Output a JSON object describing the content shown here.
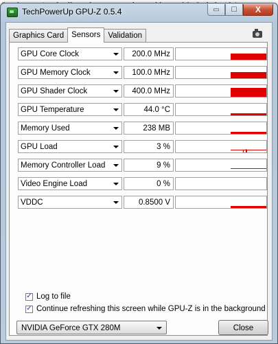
{
  "background_text": "Star International sells cool computers the world over. My Style Inside!",
  "window": {
    "title": "TechPowerUp GPU-Z 0.5.4",
    "minimize_glyph": "▭",
    "restore_glyph": "☐",
    "close_glyph": "X"
  },
  "tabs": [
    {
      "label": "Graphics Card",
      "active": false
    },
    {
      "label": "Sensors",
      "active": true
    },
    {
      "label": "Validation",
      "active": false
    }
  ],
  "sensors": [
    {
      "name": "GPU Core Clock",
      "value": "200.0 MHz",
      "level": 0.55
    },
    {
      "name": "GPU Memory Clock",
      "value": "100.0 MHz",
      "level": 0.55
    },
    {
      "name": "GPU Shader Clock",
      "value": "400.0 MHz",
      "level": 0.75
    },
    {
      "name": "GPU Temperature",
      "value": "44.0 °C",
      "level": 0.2
    },
    {
      "name": "Memory Used",
      "value": "238 MB",
      "level": 0.2
    },
    {
      "name": "GPU Load",
      "value": "3 %",
      "level": 0.03
    },
    {
      "name": "Memory Controller Load",
      "value": "9 %",
      "level": 0.09
    },
    {
      "name": "Video Engine Load",
      "value": "0 %",
      "level": 0
    },
    {
      "name": "VDDC",
      "value": "0.8500 V",
      "level": 0.2
    }
  ],
  "options": {
    "log_to_file": {
      "label": "Log to file",
      "checked": true
    },
    "continue_refresh": {
      "label": "Continue refreshing this screen while GPU-Z is in the background",
      "checked": true
    }
  },
  "gpu_select": {
    "value": "NVIDIA GeForce GTX 280M"
  },
  "close_label": "Close",
  "colors": {
    "graph_bar": "#e00000",
    "title_bar": "#b9cbdd"
  }
}
